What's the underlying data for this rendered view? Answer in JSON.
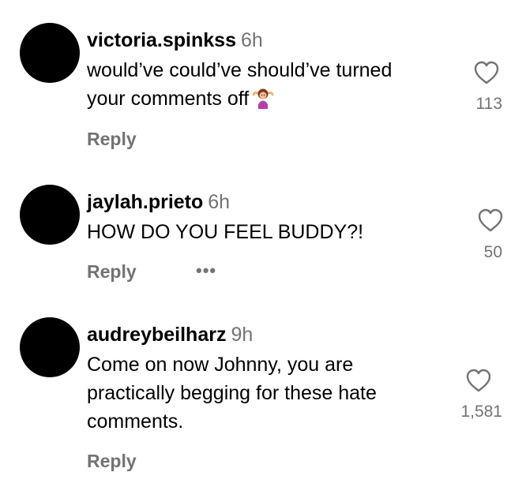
{
  "comments": [
    {
      "username": "victoria.spinkss",
      "time": "6h",
      "text_line1": "would’ve could’ve should’ve turned",
      "text_line2": "your comments off",
      "emoji": "woman-shrugging-icon",
      "likes": "113",
      "reply_label": "Reply"
    },
    {
      "username": "jaylah.prieto",
      "time": "6h",
      "text": "HOW DO YOU FEEL BUDDY?!",
      "likes": "50",
      "reply_label": "Reply",
      "more_label": "•••"
    },
    {
      "username": "audreybeilharz",
      "time": "9h",
      "text_line1": "Come on now Johnny, you are",
      "text_line2": "practically begging for these hate",
      "text_line3": "comments.",
      "likes": "1,581",
      "reply_label": "Reply"
    }
  ],
  "colors": {
    "secondary_text": "#737373",
    "avatar": "#000000"
  },
  "icons": {
    "like": "heart-outline-icon"
  }
}
